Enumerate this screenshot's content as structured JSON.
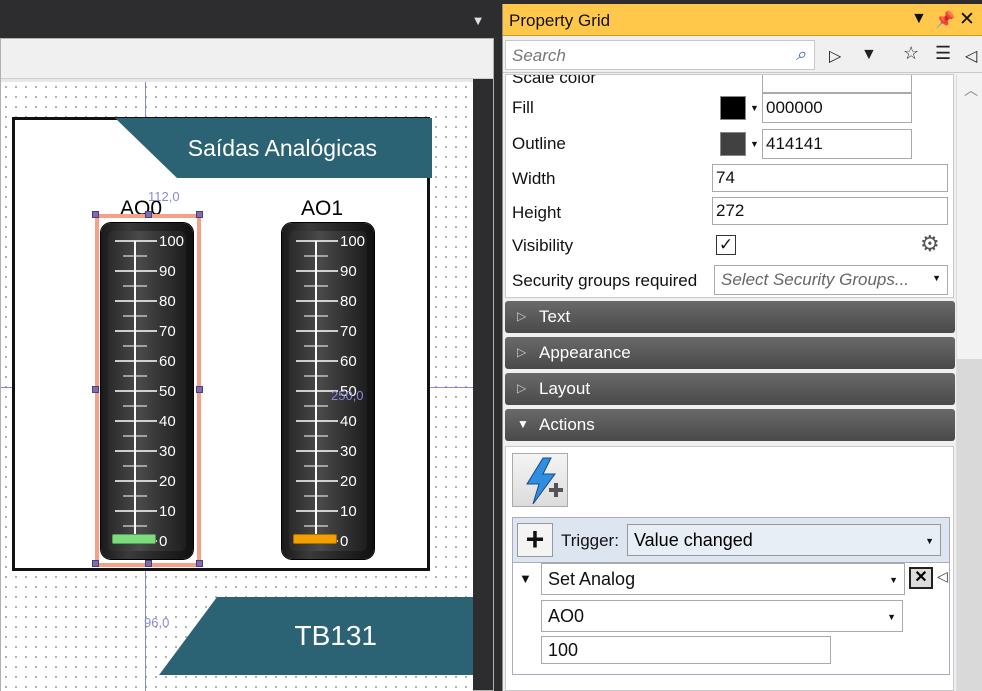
{
  "designer": {
    "coord_top": "112,0",
    "coord_center": "250,0",
    "coord_bottom": "96,0",
    "panel_title": "Saídas Analógicas",
    "footer_title": "TB131",
    "gauges": [
      {
        "label": "AO0",
        "fill_color": "#7ddc7d",
        "value": 0
      },
      {
        "label": "AO1",
        "fill_color": "#f2a000",
        "value": 0
      }
    ],
    "scale_labels": [
      "100",
      "90",
      "80",
      "70",
      "60",
      "50",
      "40",
      "30",
      "20",
      "10",
      "0"
    ]
  },
  "property_grid": {
    "title": "Property Grid",
    "pin_icon": "pin-icon",
    "close_icon": "close-icon",
    "search_placeholder": "Search",
    "partial_row_label": "Scale color",
    "fill": {
      "label": "Fill",
      "color": "#000000",
      "value": "000000"
    },
    "outline": {
      "label": "Outline",
      "color": "#414141",
      "value": "414141"
    },
    "width": {
      "label": "Width",
      "value": "74"
    },
    "height": {
      "label": "Height",
      "value": "272"
    },
    "visibility": {
      "label": "Visibility",
      "checked": true
    },
    "security": {
      "label": "Security groups required",
      "placeholder": "Select Security Groups..."
    },
    "categories": {
      "text": "Text",
      "appearance": "Appearance",
      "layout": "Layout",
      "actions": "Actions"
    },
    "actions": {
      "trigger_label": "Trigger:",
      "trigger_value": "Value changed",
      "action_type": "Set Analog",
      "target": "AO0",
      "value": "100"
    }
  }
}
